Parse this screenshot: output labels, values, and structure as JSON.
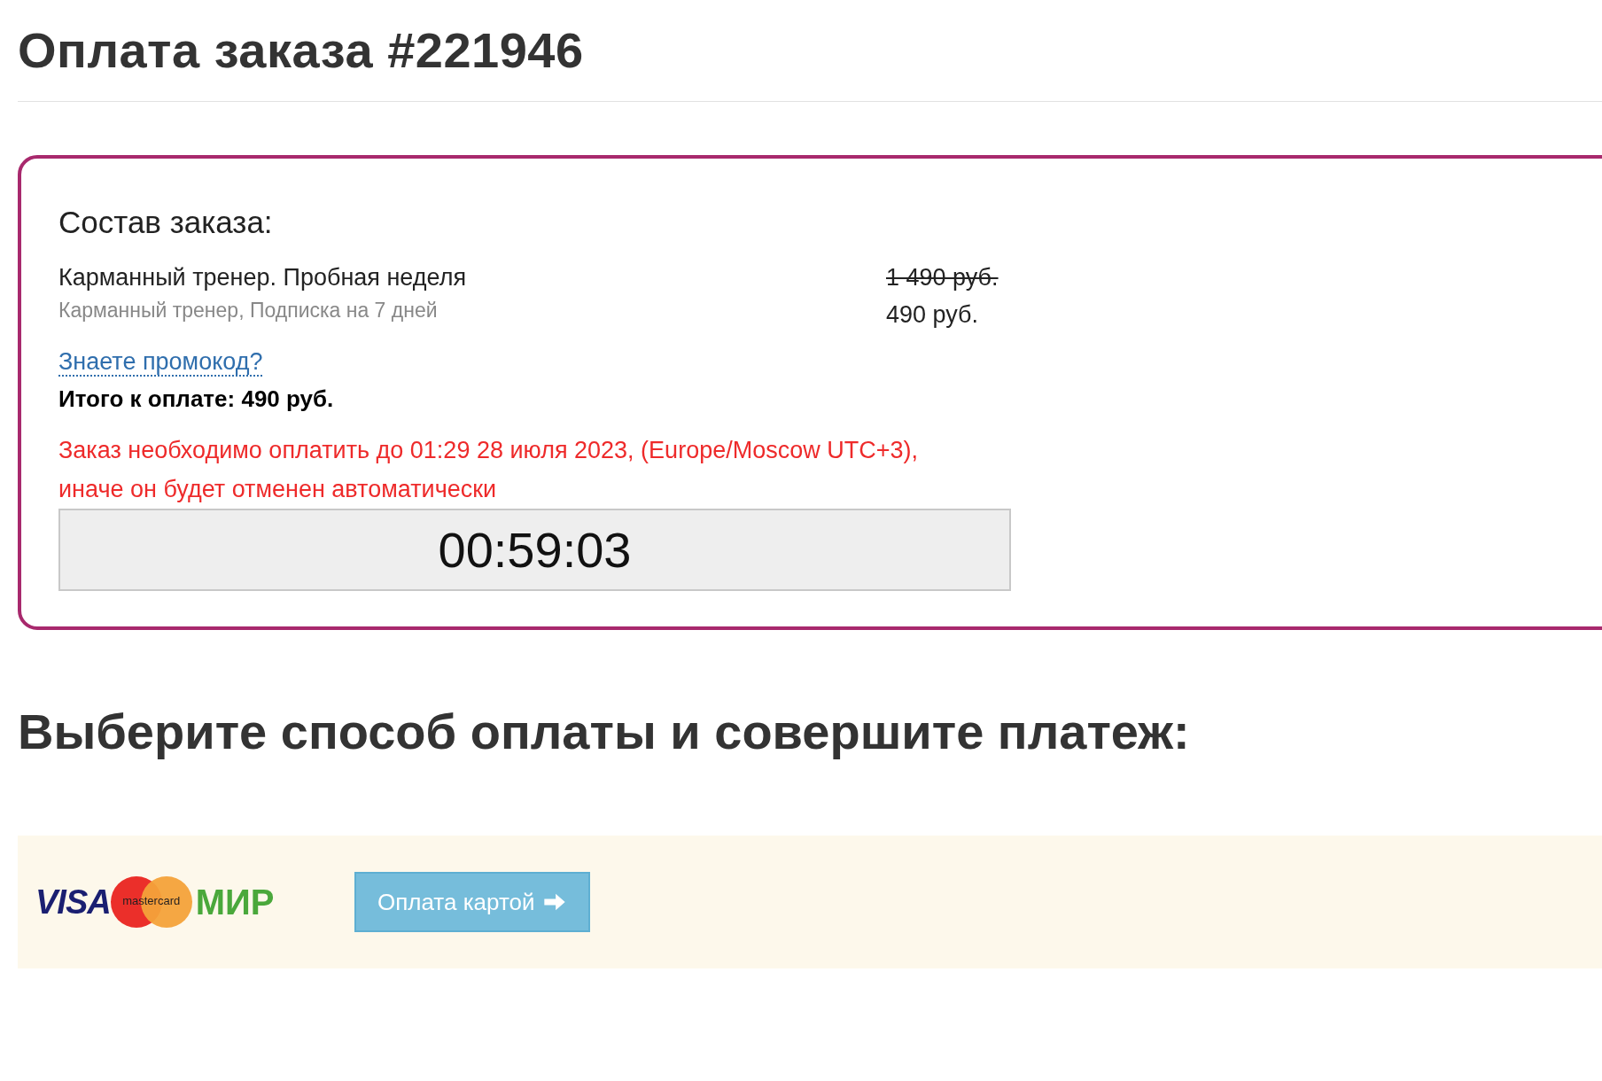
{
  "page_title": "Оплата заказа #221946",
  "order": {
    "heading": "Состав заказа:",
    "items": [
      {
        "name": "Карманный тренер. Пробная неделя",
        "description": "Карманный тренер, Подписка на 7 дней",
        "old_price": "1 490 руб.",
        "price": "490 руб."
      }
    ],
    "promo_link": "Знаете промокод?",
    "total": "Итого к оплате: 490 руб.",
    "warning": [
      "Заказ необходимо оплатить до 01:29 28 июля 2023, (Europe/Moscow UTC+3),",
      "иначе он будет отменен автоматически"
    ],
    "timer": "00:59:03"
  },
  "payment_heading": "Выберите способ оплаты и совершите платеж:",
  "payment_methods": [
    {
      "logos": [
        {
          "kind": "visa",
          "text": "VISA"
        },
        {
          "kind": "mastercard",
          "text": "mastercard"
        },
        {
          "kind": "mir",
          "text": "МИР"
        }
      ],
      "button": "Оплата картой"
    }
  ]
}
